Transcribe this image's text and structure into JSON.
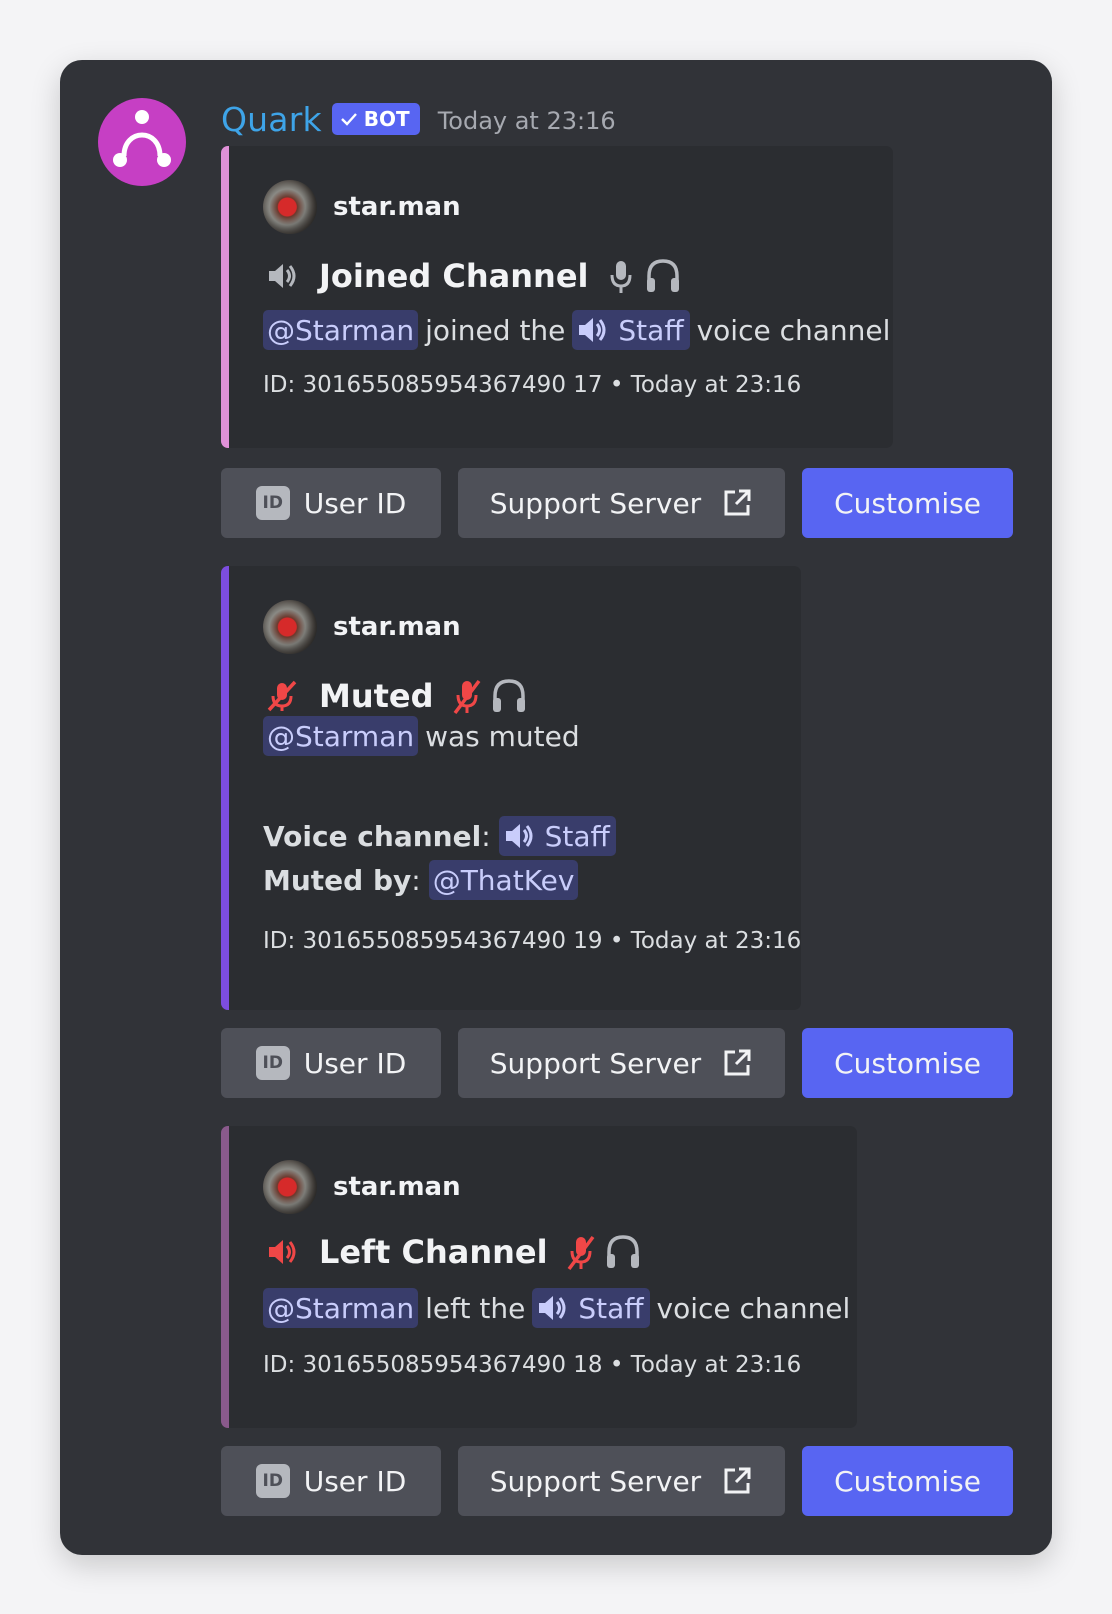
{
  "message": {
    "author": "Quark",
    "badge": "BOT",
    "timestamp": "Today at 23:16"
  },
  "embeds": [
    {
      "accent_color": "#e091d8",
      "author": "star.man",
      "title": "Joined Channel",
      "lead_icon": "speaker-icon",
      "state_icons": [
        "microphone-icon",
        "headphones-icon"
      ],
      "mention": "@Starman",
      "text_before_channel": "joined the",
      "channel": "Staff",
      "text_after_channel": "voice channel",
      "footer": "ID: 301655085954367490 17 • Today at 23:16"
    },
    {
      "accent_color": "#7c4ddf",
      "author": "star.man",
      "title": "Muted",
      "lead_icon": "muted-microphone-icon",
      "state_icons": [
        "muted-microphone-icon",
        "headphones-icon"
      ],
      "mention": "@Starman",
      "text_after_mention": "was muted",
      "fields": [
        {
          "label": "Voice channel",
          "separator": ":",
          "channel": "Staff"
        },
        {
          "label": "Muted by",
          "separator": ":",
          "mention": "@ThatKev"
        }
      ],
      "footer": "ID: 301655085954367490 19 • Today at 23:16"
    },
    {
      "accent_color": "#8a5a8c",
      "author": "star.man",
      "title": "Left Channel",
      "lead_icon": "speaker-red-icon",
      "state_icons": [
        "muted-microphone-icon",
        "headphones-icon"
      ],
      "mention": "@Starman",
      "text_before_channel": "left the",
      "channel": "Staff",
      "text_after_channel": "voice channel",
      "footer": "ID: 301655085954367490 18 • Today at 23:16"
    }
  ],
  "buttons": {
    "user_id": "User ID",
    "id_icon_text": "ID",
    "support_server": "Support Server",
    "customise": "Customise"
  },
  "colors": {
    "background": "#313338",
    "embed_background": "#2b2d31",
    "blurple": "#5865f2",
    "secondary_button": "#4e5058",
    "bot_name": "#3ea4e8",
    "bot_avatar": "#c63fc4",
    "red_icon": "#f04747"
  }
}
